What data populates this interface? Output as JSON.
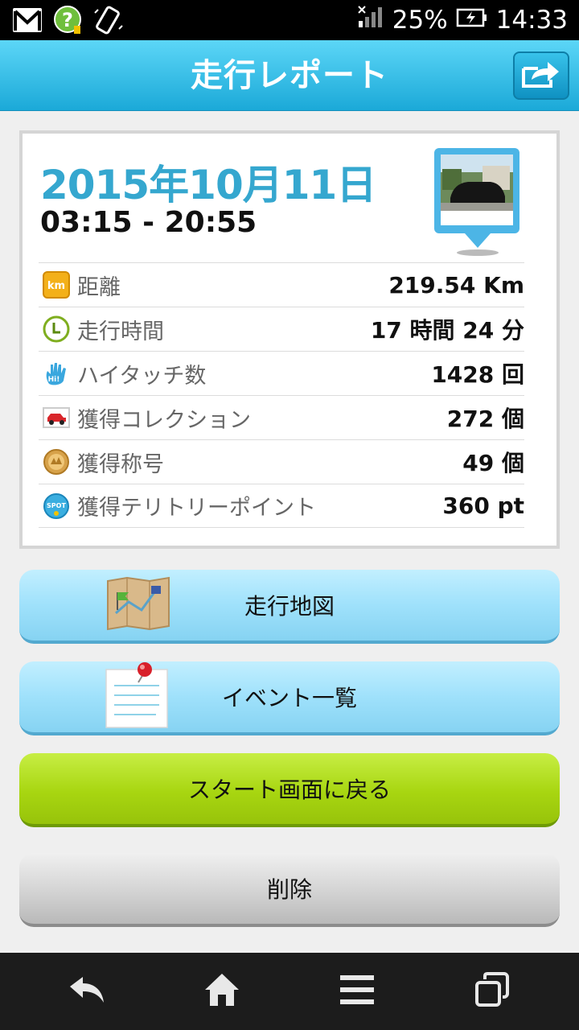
{
  "status_bar": {
    "battery": "25%",
    "time": "14:33"
  },
  "header": {
    "title": "走行レポート"
  },
  "report": {
    "date": "2015年10月11日",
    "time_range": "03:15 - 20:55",
    "stats": [
      {
        "icon": "km-icon",
        "label": "距離",
        "value": "219.54 Km"
      },
      {
        "icon": "clock-icon",
        "label": "走行時間",
        "value": "17 時間 24 分"
      },
      {
        "icon": "hand-icon",
        "label": "ハイタッチ数",
        "value": "1428 回"
      },
      {
        "icon": "car-icon",
        "label": "獲得コレクション",
        "value": "272 個"
      },
      {
        "icon": "medal-icon",
        "label": "獲得称号",
        "value": "49 個"
      },
      {
        "icon": "spot-icon",
        "label": "獲得テリトリーポイント",
        "value": "360 pt"
      }
    ]
  },
  "buttons": {
    "map": "走行地図",
    "events": "イベント一覧",
    "back_to_start": "スタート画面に戻る",
    "delete": "削除"
  },
  "colors": {
    "header": "#1ba9d8",
    "date": "#35a7cf",
    "primary_button": "#a8d611",
    "secondary_button": "#9fe1fb"
  }
}
